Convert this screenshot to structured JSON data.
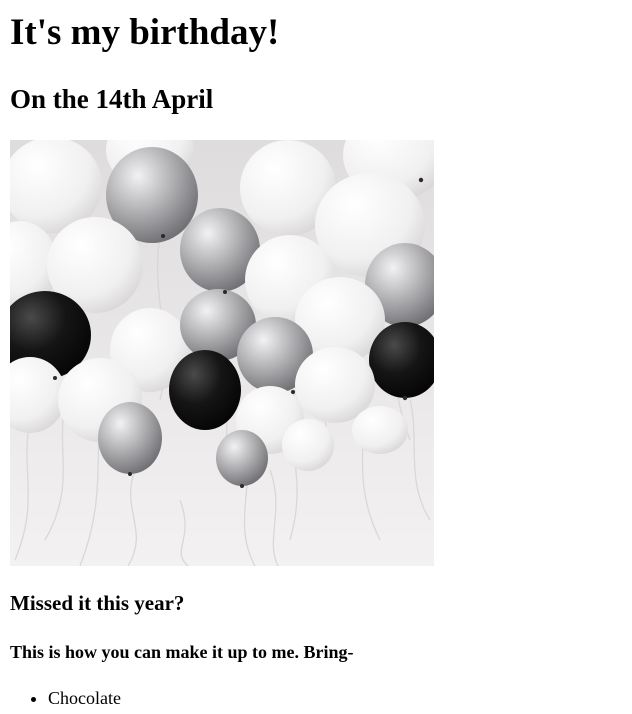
{
  "heading": "It's my birthday!",
  "subheading": "On the 14th April",
  "photo": {
    "subject": "balloons-photo",
    "colors": {
      "white": "#f7f6f6",
      "silver": "#b9b9bb",
      "black": "#111111",
      "ceiling": "#ebe8e8"
    }
  },
  "missed_heading": "Missed it this year?",
  "makeup_text": "This is how you can make it up to me. Bring-",
  "gift_list": [
    "Chocolate"
  ]
}
